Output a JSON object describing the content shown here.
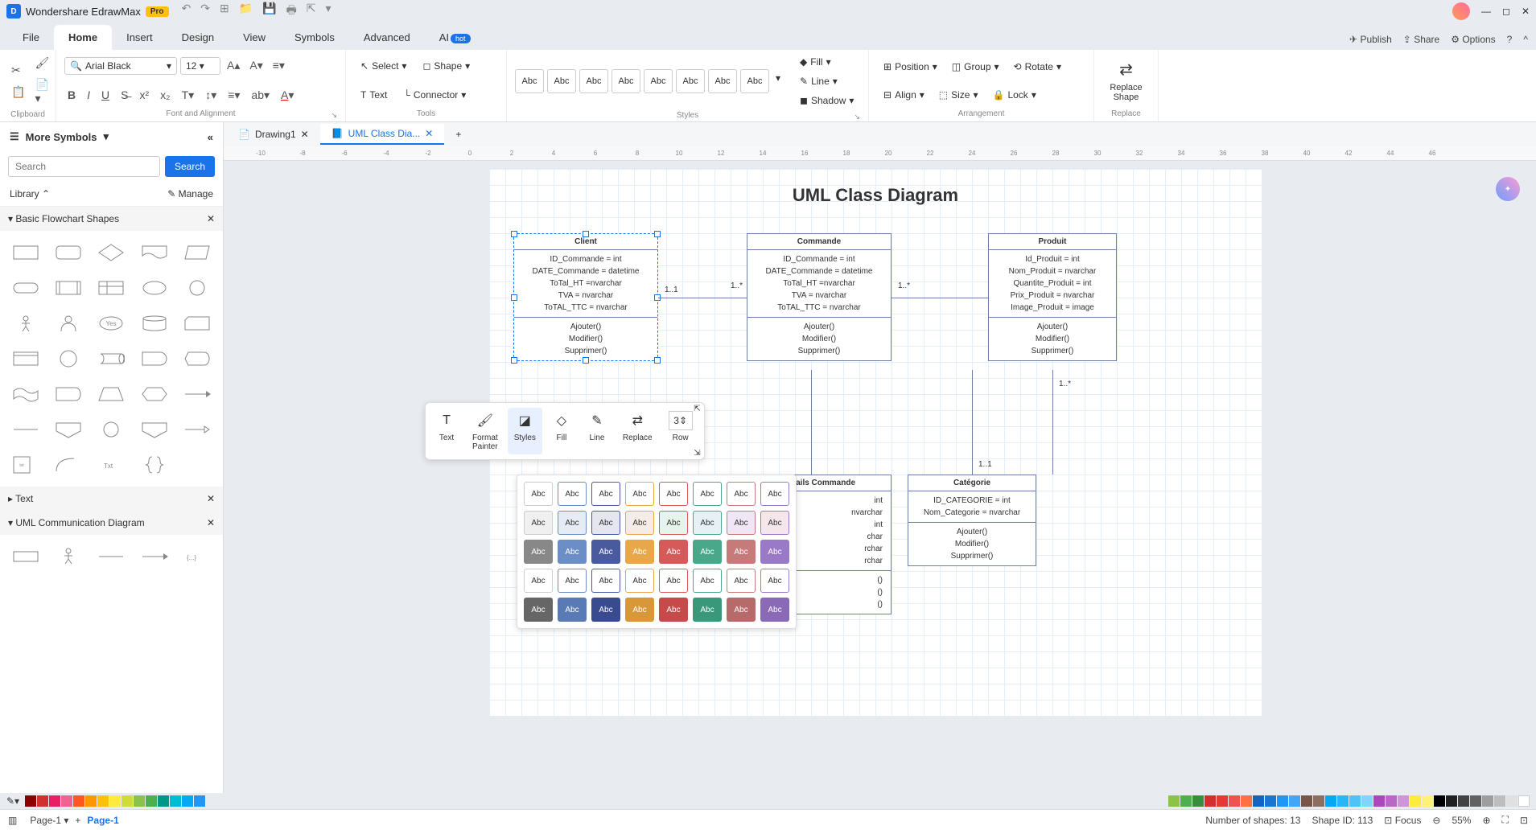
{
  "app": {
    "title": "Wondershare EdrawMax",
    "badge": "Pro"
  },
  "menubar": {
    "items": [
      "File",
      "Home",
      "Insert",
      "Design",
      "View",
      "Symbols",
      "Advanced",
      "AI"
    ],
    "active": "Home",
    "hot": "hot",
    "right": {
      "publish": "Publish",
      "share": "Share",
      "options": "Options"
    }
  },
  "ribbon": {
    "clipboard": {
      "label": "Clipboard"
    },
    "font": {
      "family": "Arial Black",
      "size": "12",
      "label": "Font and Alignment"
    },
    "tools": {
      "select": "Select",
      "shape": "Shape",
      "text": "Text",
      "connector": "Connector",
      "label": "Tools"
    },
    "styles": {
      "label": "Styles",
      "swatches": [
        "Abc",
        "Abc",
        "Abc",
        "Abc",
        "Abc",
        "Abc",
        "Abc",
        "Abc"
      ],
      "fill": "Fill",
      "line": "Line",
      "shadow": "Shadow"
    },
    "arrange": {
      "position": "Position",
      "group": "Group",
      "rotate": "Rotate",
      "align": "Align",
      "size": "Size",
      "lock": "Lock",
      "label": "Arrangement"
    },
    "replace": {
      "label": "Replace",
      "btn": "Replace\nShape"
    }
  },
  "left": {
    "more": "More Symbols",
    "search_placeholder": "Search",
    "search_btn": "Search",
    "library": "Library",
    "manage": "Manage",
    "cats": {
      "basic": "Basic Flowchart Shapes",
      "text": "Text",
      "uml": "UML Communication Diagram"
    }
  },
  "tabs": {
    "t1": "Drawing1",
    "t2": "UML Class Dia..."
  },
  "ruler": [
    "-10",
    "-8",
    "-6",
    "-4",
    "-2",
    "0",
    "2",
    "4",
    "6",
    "8",
    "10",
    "12",
    "14",
    "16",
    "18",
    "20",
    "22",
    "24",
    "26",
    "28",
    "30",
    "32",
    "34",
    "36",
    "38",
    "40",
    "42",
    "44",
    "46"
  ],
  "diagram": {
    "title": "UML Class Diagram",
    "client": {
      "name": "Client",
      "attrs": [
        "ID_Commande = int",
        "DATE_Commande = datetime",
        "ToTal_HT =nvarchar",
        "TVA = nvarchar",
        "ToTAL_TTC = nvarchar"
      ],
      "ops": [
        "Ajouter()",
        "Modifier()",
        "Supprimer()"
      ]
    },
    "commande": {
      "name": "Commande",
      "attrs": [
        "ID_Commande = int",
        "DATE_Commande = datetime",
        "ToTal_HT =nvarchar",
        "TVA = nvarchar",
        "ToTAL_TTC = nvarchar"
      ],
      "ops": [
        "Ajouter()",
        "Modifier()",
        "Supprimer()"
      ]
    },
    "produit": {
      "name": "Produit",
      "attrs": [
        "Id_Produit = int",
        "Nom_Produit = nvarchar",
        "Quantite_Produit = int",
        "Prix_Produit = nvarchar",
        "Image_Produit = image"
      ],
      "ops": [
        "Ajouter()",
        "Modifier()",
        "Supprimer()"
      ]
    },
    "details": {
      "name": "Détails Commande",
      "attrs": [
        "int",
        "nvarchar",
        "int",
        "char",
        "rchar",
        "rchar"
      ],
      "ops": [
        "()",
        "()",
        "()"
      ]
    },
    "categorie": {
      "name": "Catégorie",
      "attrs": [
        "ID_CATEGORIE = int",
        "Nom_Categorie = nvarchar"
      ],
      "ops": [
        "Ajouter()",
        "Modifier()",
        "Supprimer()"
      ]
    },
    "mults": {
      "m1": "1..1",
      "m2": "1..*",
      "m3": "1..*",
      "m4": "1..*",
      "m5": "1..1"
    }
  },
  "float": {
    "text": "Text",
    "format": "Format\nPainter",
    "styles": "Styles",
    "fill": "Fill",
    "line": "Line",
    "replace": "Replace",
    "row": "Row",
    "row_val": "3"
  },
  "style_popup_label": "Abc",
  "status": {
    "page_select": "Page-1",
    "page_tab": "Page-1",
    "shapes_count": "Number of shapes: 13",
    "shape_id": "Shape ID: 113",
    "focus": "Focus",
    "zoom": "55%"
  }
}
